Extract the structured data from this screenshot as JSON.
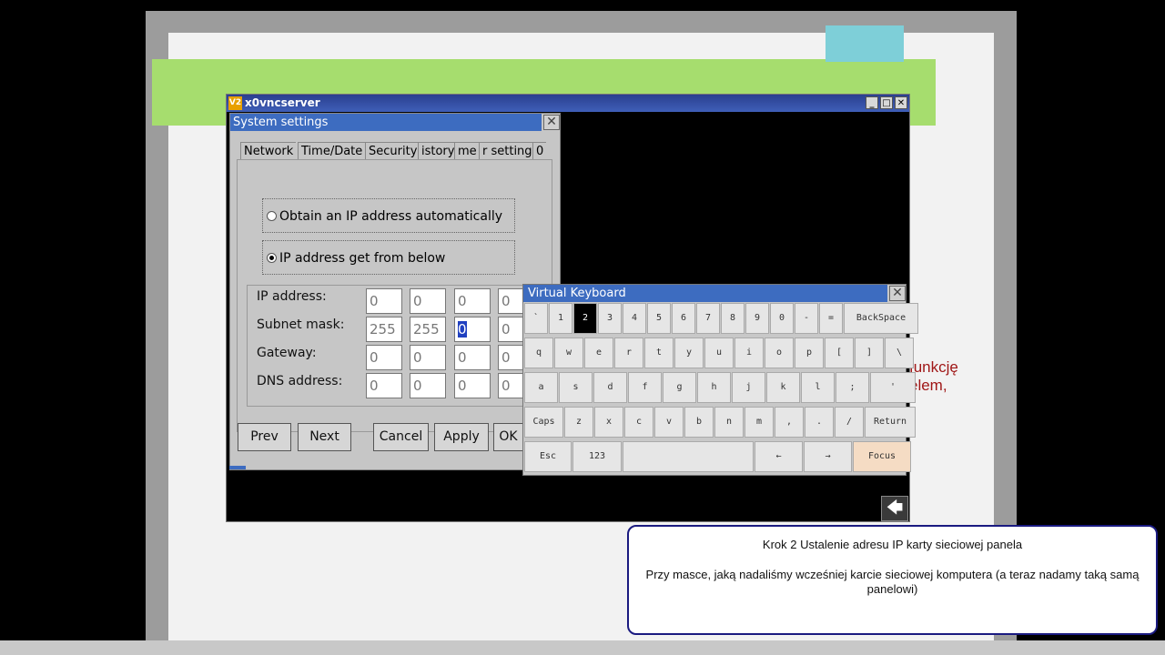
{
  "slide": {
    "side_text": "funkcję\nelem,"
  },
  "vnc_window": {
    "title": "x0vncserver",
    "icon": "V2",
    "min": "_",
    "max": "□",
    "close": "✕"
  },
  "system_settings": {
    "title": "System settings",
    "close": "✕",
    "tabs": [
      "Network",
      "Time/Date",
      "Security",
      "istory",
      "me",
      "r setting",
      "0"
    ],
    "radio_auto": "Obtain an IP address automatically",
    "radio_manual": "IP address get from below",
    "ip_labels": {
      "ip": "IP address:",
      "mask": "Subnet mask:",
      "gateway": "Gateway:",
      "dns": "DNS address:"
    },
    "ip": [
      "0",
      "0",
      "0",
      "0"
    ],
    "mask": [
      "255",
      "255",
      "0",
      "0"
    ],
    "gateway": [
      "0",
      "0",
      "0",
      "0"
    ],
    "dns": [
      "0",
      "0",
      "0",
      "0"
    ],
    "buttons": {
      "prev": "Prev",
      "next": "Next",
      "cancel": "Cancel",
      "apply": "Apply",
      "ok": "OK"
    }
  },
  "virtual_keyboard": {
    "title": "Virtual Keyboard",
    "close": "✕",
    "row1": [
      "`",
      "1",
      "2",
      "3",
      "4",
      "5",
      "6",
      "7",
      "8",
      "9",
      "0",
      "-",
      "=",
      "BackSpace"
    ],
    "row2": [
      "q",
      "w",
      "e",
      "r",
      "t",
      "y",
      "u",
      "i",
      "o",
      "p",
      "[",
      "]",
      "\\"
    ],
    "row3": [
      "a",
      "s",
      "d",
      "f",
      "g",
      "h",
      "j",
      "k",
      "l",
      ";",
      "'"
    ],
    "row4": [
      "Caps",
      "z",
      "x",
      "c",
      "v",
      "b",
      "n",
      "m",
      ",",
      ".",
      "/",
      "Return"
    ],
    "row5": [
      "Esc",
      "123",
      "",
      "←",
      "→",
      "Focus"
    ]
  },
  "back_button": "🡄",
  "info_box": {
    "line1": "Krok 2  Ustalenie adresu IP karty sieciowej panela",
    "line2": "Przy masce, jaką nadaliśmy wcześniej karcie sieciowej komputera (a teraz nadamy taką samą panelowi)"
  }
}
